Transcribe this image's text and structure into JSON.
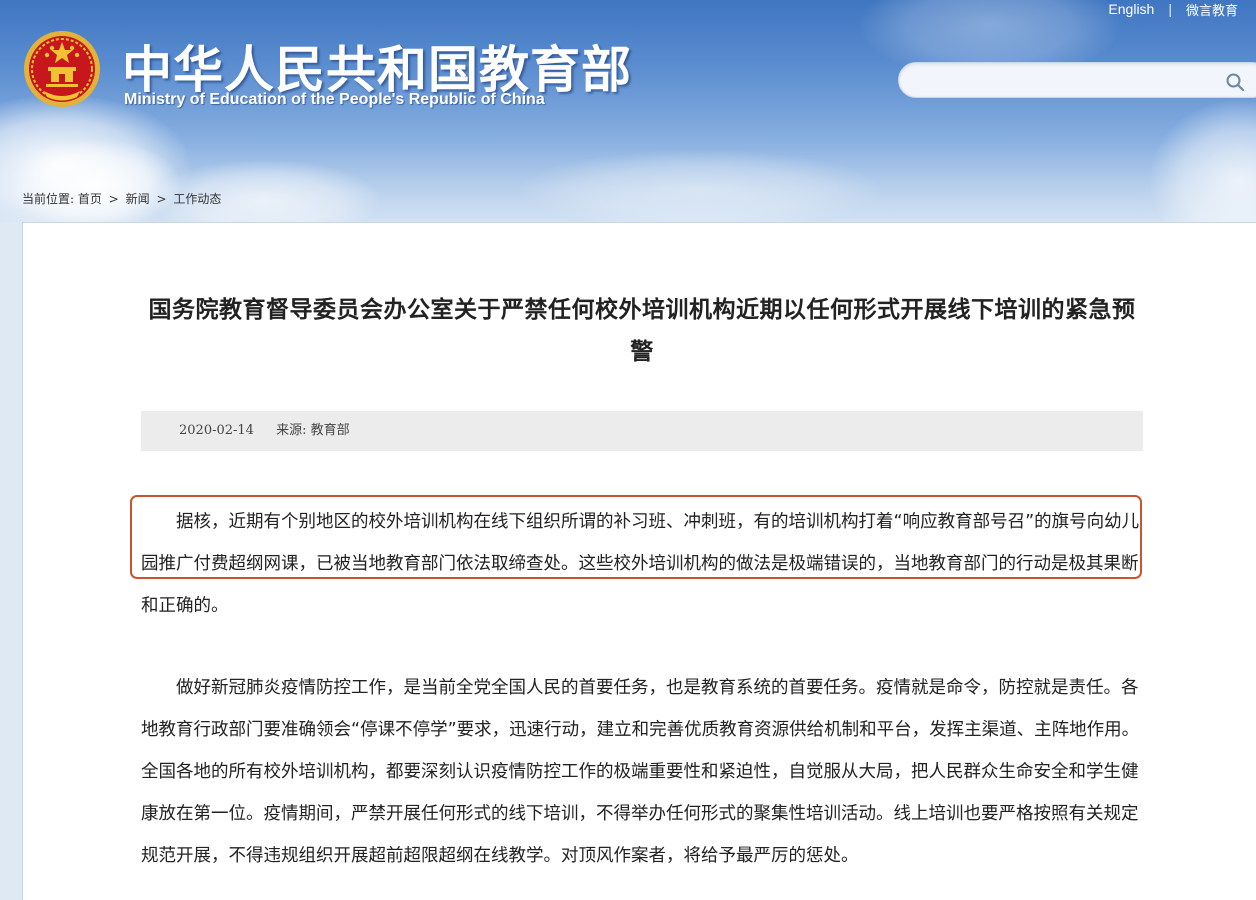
{
  "header": {
    "title_cn": "中华人民共和国教育部",
    "title_en": "Ministry of Education of the People's Republic of China",
    "links": {
      "english": "English",
      "weiyan": "微言教育",
      "separator": "|"
    },
    "search": {
      "placeholder": "",
      "value": ""
    }
  },
  "breadcrumb": {
    "prefix": "当前位置:",
    "items": [
      "首页",
      "新闻",
      "工作动态"
    ],
    "separator": ">"
  },
  "article": {
    "title": "国务院教育督导委员会办公室关于严禁任何校外培训机构近期以任何形式开展线下培训的紧急预警",
    "date": "2020-02-14",
    "source_label": "来源:",
    "source": "教育部",
    "paragraphs": [
      "据核，近期有个别地区的校外培训机构在线下组织所谓的补习班、冲刺班，有的培训机构打着“响应教育部号召”的旗号向幼儿园推广付费超纲网课，已被当地教育部门依法取缔查处。这些校外培训机构的做法是极端错误的，当地教育部门的行动是极其果断和正确的。",
      "做好新冠肺炎疫情防控工作，是当前全党全国人民的首要任务，也是教育系统的首要任务。疫情就是命令，防控就是责任。各地教育行政部门要准确领会“停课不停学”要求，迅速行动，建立和完善优质教育资源供给机制和平台，发挥主渠道、主阵地作用。全国各地的所有校外培训机构，都要深刻认识疫情防控工作的极端重要性和紧迫性，自觉服从大局，把人民群众生命安全和学生健康放在第一位。疫情期间，严禁开展任何形式的线下培训，不得举办任何形式的聚集性培训活动。线上培训也要严格按照有关规定规范开展，不得违规组织开展超前超限超纲在线教学。对顶风作案者，将给予最严厉的惩处。"
    ]
  },
  "icons": {
    "emblem": "national-emblem-icon",
    "search": "search-icon"
  },
  "colors": {
    "header_blue": "#3f76c1",
    "highlight_border": "#c8552f",
    "meta_bar": "#ececec",
    "emblem_red": "#c8161d",
    "emblem_gold": "#f1c232"
  }
}
